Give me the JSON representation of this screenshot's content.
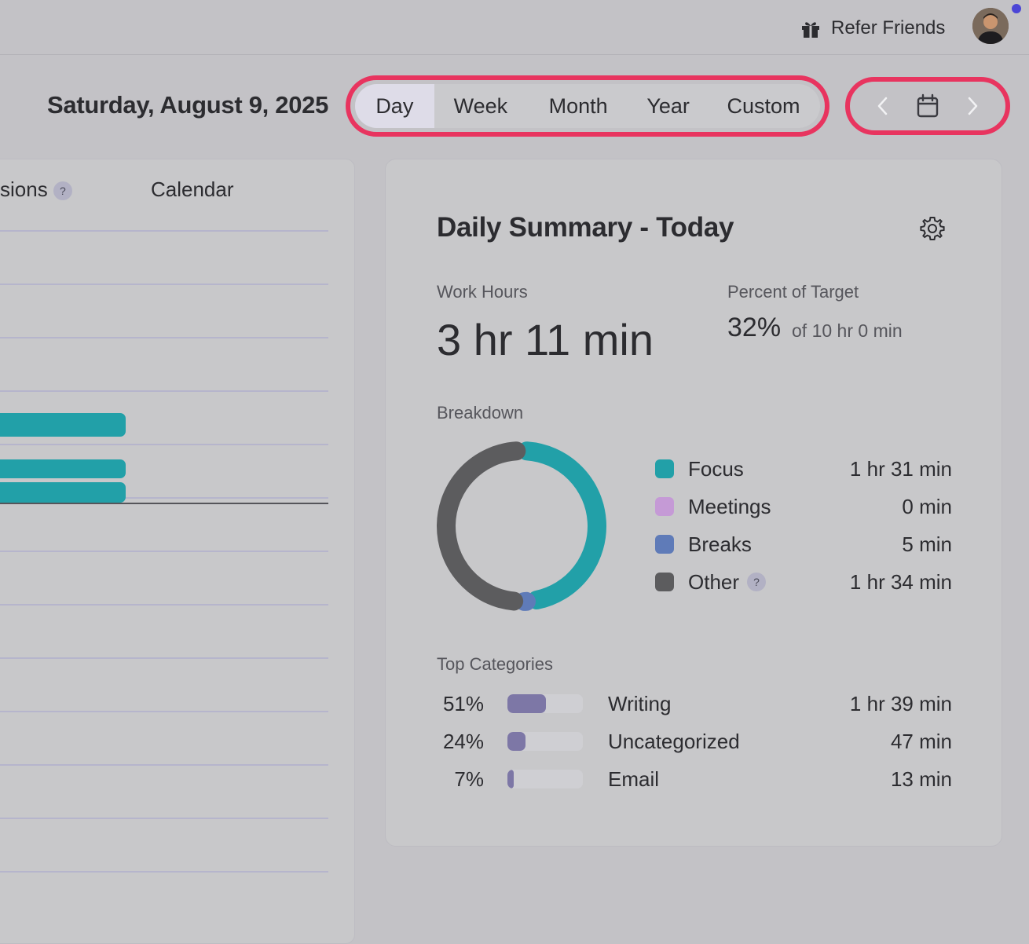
{
  "header": {
    "refer_label": "Refer Friends",
    "refer_icon": "gift-icon"
  },
  "date_title": "Saturday, August 9, 2025",
  "range_tabs": [
    {
      "label": "Day",
      "active": true
    },
    {
      "label": "Week",
      "active": false
    },
    {
      "label": "Month",
      "active": false
    },
    {
      "label": "Year",
      "active": false
    },
    {
      "label": "Custom",
      "active": false
    }
  ],
  "left_panel": {
    "col1": "sions",
    "col1_help": "?",
    "col2": "Calendar"
  },
  "summary": {
    "title": "Daily Summary - Today",
    "work_hours_label": "Work Hours",
    "work_hours_value": "3 hr 11 min",
    "percent_label": "Percent of Target",
    "percent_value": "32%",
    "percent_of": "of 10 hr 0 min",
    "breakdown_label": "Breakdown",
    "breakdown": [
      {
        "name": "Focus",
        "time": "1 hr 31 min",
        "minutes": 91,
        "color": "#22a0a8"
      },
      {
        "name": "Meetings",
        "time": "0 min",
        "minutes": 0,
        "color": "#c59ad6"
      },
      {
        "name": "Breaks",
        "time": "5 min",
        "minutes": 5,
        "color": "#5f7bb8"
      },
      {
        "name": "Other",
        "time": "1 hr 34 min",
        "minutes": 94,
        "color": "#5c5c5e",
        "help": "?"
      }
    ],
    "top_categories_label": "Top Categories",
    "top_categories": [
      {
        "pct": "51%",
        "fraction": 0.51,
        "name": "Writing",
        "time": "1 hr 39 min"
      },
      {
        "pct": "24%",
        "fraction": 0.24,
        "name": "Uncategorized",
        "time": "47 min"
      },
      {
        "pct": "7%",
        "fraction": 0.07,
        "name": "Email",
        "time": "13 min"
      }
    ]
  }
}
